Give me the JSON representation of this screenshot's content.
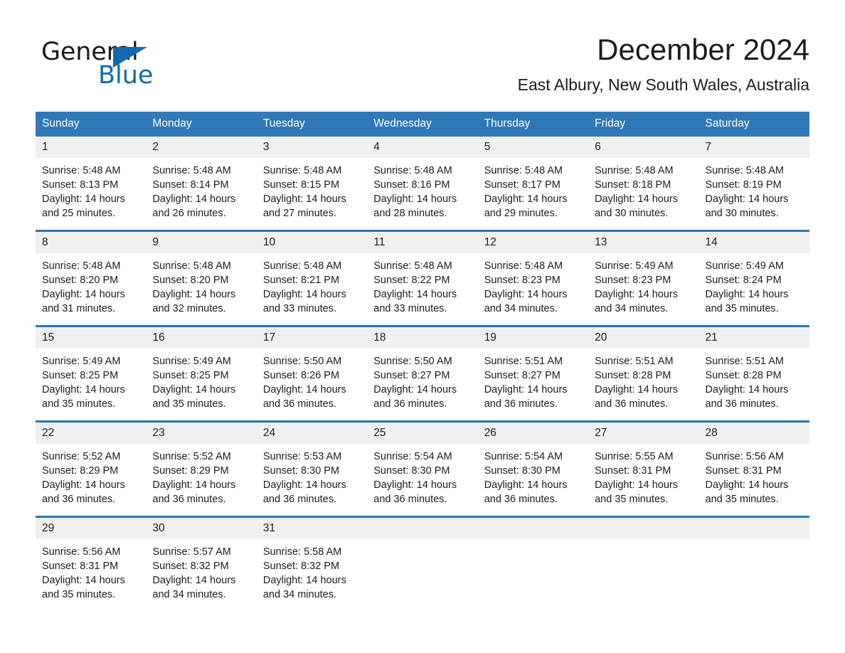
{
  "brand": {
    "name_part1": "General",
    "name_part2": "Blue",
    "accent_color": "#1269b0",
    "triangle_icon": "triangle-icon"
  },
  "header": {
    "title": "December 2024",
    "location": "East Albury, New South Wales, Australia"
  },
  "calendar": {
    "header_bg": "#3079b8",
    "row_divider_color": "#2e74b5",
    "daynum_bg": "#f0f0f0",
    "weekdays": [
      "Sunday",
      "Monday",
      "Tuesday",
      "Wednesday",
      "Thursday",
      "Friday",
      "Saturday"
    ],
    "weeks": [
      [
        {
          "day": "1",
          "sunrise": "Sunrise: 5:48 AM",
          "sunset": "Sunset: 8:13 PM",
          "daylight": "Daylight: 14 hours and 25 minutes."
        },
        {
          "day": "2",
          "sunrise": "Sunrise: 5:48 AM",
          "sunset": "Sunset: 8:14 PM",
          "daylight": "Daylight: 14 hours and 26 minutes."
        },
        {
          "day": "3",
          "sunrise": "Sunrise: 5:48 AM",
          "sunset": "Sunset: 8:15 PM",
          "daylight": "Daylight: 14 hours and 27 minutes."
        },
        {
          "day": "4",
          "sunrise": "Sunrise: 5:48 AM",
          "sunset": "Sunset: 8:16 PM",
          "daylight": "Daylight: 14 hours and 28 minutes."
        },
        {
          "day": "5",
          "sunrise": "Sunrise: 5:48 AM",
          "sunset": "Sunset: 8:17 PM",
          "daylight": "Daylight: 14 hours and 29 minutes."
        },
        {
          "day": "6",
          "sunrise": "Sunrise: 5:48 AM",
          "sunset": "Sunset: 8:18 PM",
          "daylight": "Daylight: 14 hours and 30 minutes."
        },
        {
          "day": "7",
          "sunrise": "Sunrise: 5:48 AM",
          "sunset": "Sunset: 8:19 PM",
          "daylight": "Daylight: 14 hours and 30 minutes."
        }
      ],
      [
        {
          "day": "8",
          "sunrise": "Sunrise: 5:48 AM",
          "sunset": "Sunset: 8:20 PM",
          "daylight": "Daylight: 14 hours and 31 minutes."
        },
        {
          "day": "9",
          "sunrise": "Sunrise: 5:48 AM",
          "sunset": "Sunset: 8:20 PM",
          "daylight": "Daylight: 14 hours and 32 minutes."
        },
        {
          "day": "10",
          "sunrise": "Sunrise: 5:48 AM",
          "sunset": "Sunset: 8:21 PM",
          "daylight": "Daylight: 14 hours and 33 minutes."
        },
        {
          "day": "11",
          "sunrise": "Sunrise: 5:48 AM",
          "sunset": "Sunset: 8:22 PM",
          "daylight": "Daylight: 14 hours and 33 minutes."
        },
        {
          "day": "12",
          "sunrise": "Sunrise: 5:48 AM",
          "sunset": "Sunset: 8:23 PM",
          "daylight": "Daylight: 14 hours and 34 minutes."
        },
        {
          "day": "13",
          "sunrise": "Sunrise: 5:49 AM",
          "sunset": "Sunset: 8:23 PM",
          "daylight": "Daylight: 14 hours and 34 minutes."
        },
        {
          "day": "14",
          "sunrise": "Sunrise: 5:49 AM",
          "sunset": "Sunset: 8:24 PM",
          "daylight": "Daylight: 14 hours and 35 minutes."
        }
      ],
      [
        {
          "day": "15",
          "sunrise": "Sunrise: 5:49 AM",
          "sunset": "Sunset: 8:25 PM",
          "daylight": "Daylight: 14 hours and 35 minutes."
        },
        {
          "day": "16",
          "sunrise": "Sunrise: 5:49 AM",
          "sunset": "Sunset: 8:25 PM",
          "daylight": "Daylight: 14 hours and 35 minutes."
        },
        {
          "day": "17",
          "sunrise": "Sunrise: 5:50 AM",
          "sunset": "Sunset: 8:26 PM",
          "daylight": "Daylight: 14 hours and 36 minutes."
        },
        {
          "day": "18",
          "sunrise": "Sunrise: 5:50 AM",
          "sunset": "Sunset: 8:27 PM",
          "daylight": "Daylight: 14 hours and 36 minutes."
        },
        {
          "day": "19",
          "sunrise": "Sunrise: 5:51 AM",
          "sunset": "Sunset: 8:27 PM",
          "daylight": "Daylight: 14 hours and 36 minutes."
        },
        {
          "day": "20",
          "sunrise": "Sunrise: 5:51 AM",
          "sunset": "Sunset: 8:28 PM",
          "daylight": "Daylight: 14 hours and 36 minutes."
        },
        {
          "day": "21",
          "sunrise": "Sunrise: 5:51 AM",
          "sunset": "Sunset: 8:28 PM",
          "daylight": "Daylight: 14 hours and 36 minutes."
        }
      ],
      [
        {
          "day": "22",
          "sunrise": "Sunrise: 5:52 AM",
          "sunset": "Sunset: 8:29 PM",
          "daylight": "Daylight: 14 hours and 36 minutes."
        },
        {
          "day": "23",
          "sunrise": "Sunrise: 5:52 AM",
          "sunset": "Sunset: 8:29 PM",
          "daylight": "Daylight: 14 hours and 36 minutes."
        },
        {
          "day": "24",
          "sunrise": "Sunrise: 5:53 AM",
          "sunset": "Sunset: 8:30 PM",
          "daylight": "Daylight: 14 hours and 36 minutes."
        },
        {
          "day": "25",
          "sunrise": "Sunrise: 5:54 AM",
          "sunset": "Sunset: 8:30 PM",
          "daylight": "Daylight: 14 hours and 36 minutes."
        },
        {
          "day": "26",
          "sunrise": "Sunrise: 5:54 AM",
          "sunset": "Sunset: 8:30 PM",
          "daylight": "Daylight: 14 hours and 36 minutes."
        },
        {
          "day": "27",
          "sunrise": "Sunrise: 5:55 AM",
          "sunset": "Sunset: 8:31 PM",
          "daylight": "Daylight: 14 hours and 35 minutes."
        },
        {
          "day": "28",
          "sunrise": "Sunrise: 5:56 AM",
          "sunset": "Sunset: 8:31 PM",
          "daylight": "Daylight: 14 hours and 35 minutes."
        }
      ],
      [
        {
          "day": "29",
          "sunrise": "Sunrise: 5:56 AM",
          "sunset": "Sunset: 8:31 PM",
          "daylight": "Daylight: 14 hours and 35 minutes."
        },
        {
          "day": "30",
          "sunrise": "Sunrise: 5:57 AM",
          "sunset": "Sunset: 8:32 PM",
          "daylight": "Daylight: 14 hours and 34 minutes."
        },
        {
          "day": "31",
          "sunrise": "Sunrise: 5:58 AM",
          "sunset": "Sunset: 8:32 PM",
          "daylight": "Daylight: 14 hours and 34 minutes."
        },
        {
          "day": "",
          "sunrise": "",
          "sunset": "",
          "daylight": ""
        },
        {
          "day": "",
          "sunrise": "",
          "sunset": "",
          "daylight": ""
        },
        {
          "day": "",
          "sunrise": "",
          "sunset": "",
          "daylight": ""
        },
        {
          "day": "",
          "sunrise": "",
          "sunset": "",
          "daylight": ""
        }
      ]
    ]
  }
}
